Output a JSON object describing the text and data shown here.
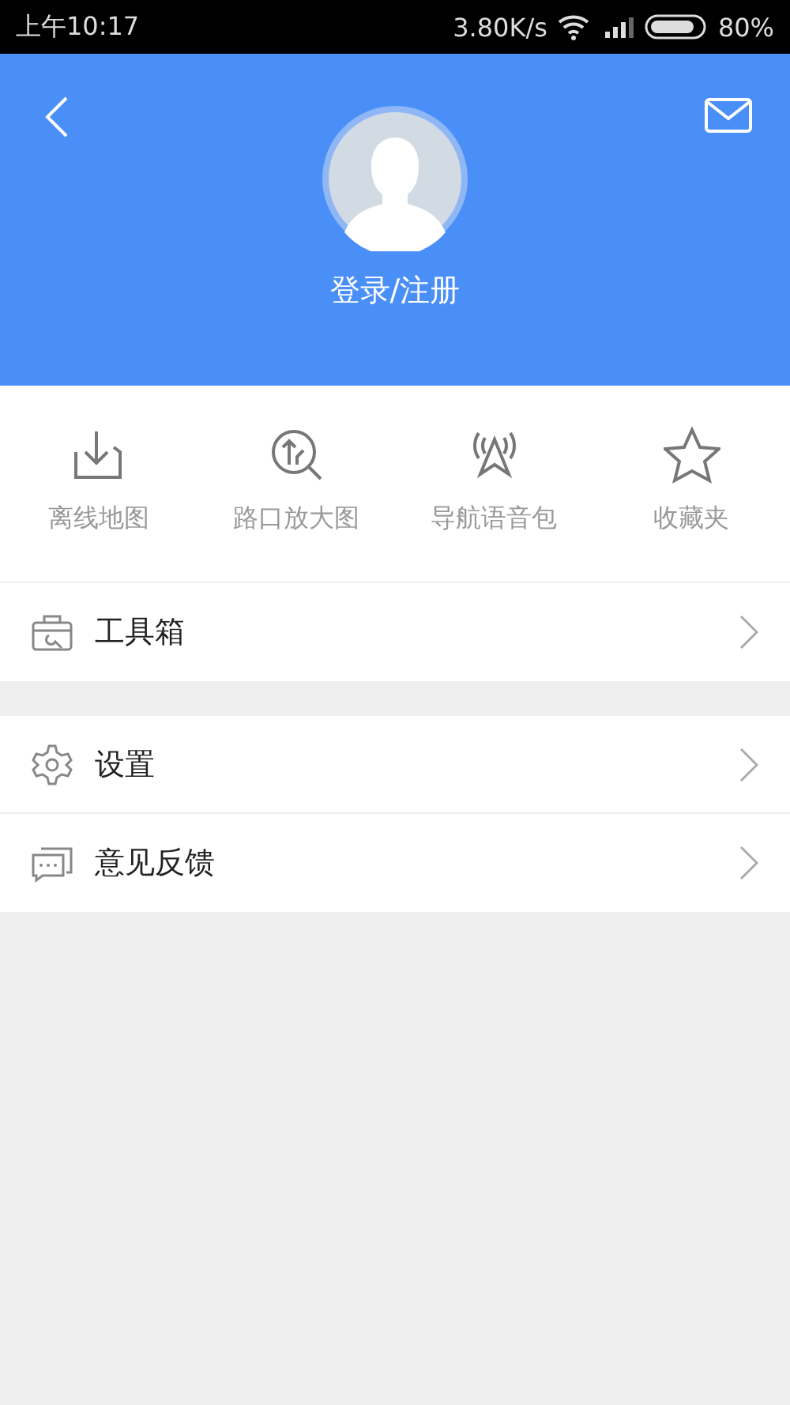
{
  "status_bar": {
    "time": "上午10:17",
    "speed": "3.80K/s",
    "battery": "80%"
  },
  "header": {
    "login": "登录/注册"
  },
  "quick_actions": [
    {
      "label": "离线地图"
    },
    {
      "label": "路口放大图"
    },
    {
      "label": "导航语音包"
    },
    {
      "label": "收藏夹"
    }
  ],
  "menu_groups": [
    [
      {
        "label": "工具箱"
      }
    ],
    [
      {
        "label": "设置"
      },
      {
        "label": "意见反馈"
      }
    ]
  ]
}
